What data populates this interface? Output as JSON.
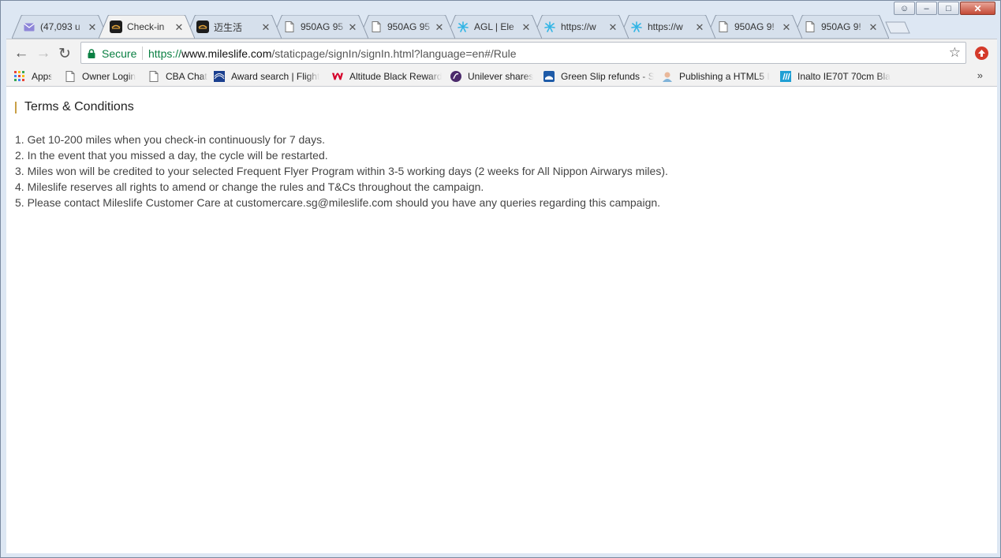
{
  "window": {
    "buttons": {
      "user": "☺",
      "minimize": "–",
      "maximize": "□",
      "close": "✕"
    }
  },
  "tabs": [
    {
      "title": "(47,093 u",
      "icon": "mail-icon",
      "active": false
    },
    {
      "title": "Check-in",
      "icon": "mileslife-icon",
      "active": true
    },
    {
      "title": "迈生活",
      "icon": "mileslife-icon",
      "active": false
    },
    {
      "title": "950AG 95",
      "icon": "page-icon",
      "active": false
    },
    {
      "title": "950AG 95",
      "icon": "page-icon",
      "active": false
    },
    {
      "title": "AGL | Ele",
      "icon": "agl-icon",
      "active": false
    },
    {
      "title": "https://w",
      "icon": "agl-icon",
      "active": false
    },
    {
      "title": "https://w",
      "icon": "agl-icon",
      "active": false
    },
    {
      "title": "950AG 9!",
      "icon": "page-icon",
      "active": false
    },
    {
      "title": "950AG 9!",
      "icon": "page-icon",
      "active": false
    }
  ],
  "tab_close_glyph": "✕",
  "toolbar": {
    "back": "←",
    "forward": "→",
    "reload": "↻",
    "secure_label": "Secure",
    "url_scheme": "https://",
    "url_host": "www.mileslife.com",
    "url_path": "/staticpage/signIn/signIn.html?language=en#/Rule",
    "star": "☆"
  },
  "bookmarks": [
    {
      "label": "Apps",
      "icon": "apps-grid-icon"
    },
    {
      "label": "Owner Login",
      "icon": "page-icon"
    },
    {
      "label": "CBA Chat",
      "icon": "page-icon"
    },
    {
      "label": "Award search | Flight",
      "icon": "united-icon"
    },
    {
      "label": "Altitude Black Reward",
      "icon": "westpac-icon"
    },
    {
      "label": "Unilever shares",
      "icon": "unilever-icon"
    },
    {
      "label": "Green Slip refunds - S",
      "icon": "nsw-icon"
    },
    {
      "label": "Publishing a HTML5 I",
      "icon": "avatar-icon"
    },
    {
      "label": "Inalto IE70T 70cm Bla",
      "icon": "inalto-icon"
    }
  ],
  "bookmarks_more": "»",
  "page": {
    "heading": "Terms & Conditions",
    "rules": [
      "1. Get 10-200 miles when you check-in continuously for 7 days.",
      "2. In the event that you missed a day, the cycle will be restarted.",
      "3. Miles won will be credited to your selected Frequent Flyer Program within 3-5 working days (2 weeks for All Nippon Airwarys miles).",
      "4. Mileslife reserves all rights to amend or change the rules and T&Cs throughout the campaign.",
      "5. Please contact Mileslife Customer Care at customercare.sg@mileslife.com should you have any queries regarding this campaign."
    ]
  },
  "colors": {
    "secure_green": "#0b8043",
    "heading_bar": "#c9a046",
    "body_text": "#444444"
  }
}
